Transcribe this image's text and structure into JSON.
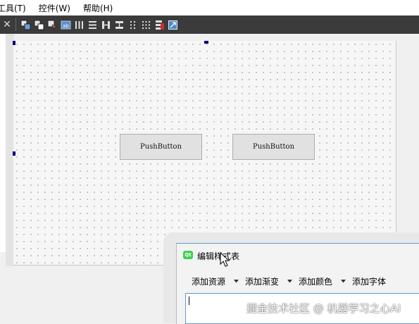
{
  "menubar": {
    "items": [
      {
        "label": "工具(T)"
      },
      {
        "label": "控件(W)"
      },
      {
        "label": "帮助(H)"
      }
    ]
  },
  "toolbar": {
    "close_icon": "close-icon",
    "buttons": [
      "add-widgets-icon",
      "remove-widgets-icon",
      "edit-signals-icon",
      "edit-buddies-icon",
      "layout-horizontal-icon",
      "layout-vertical-icon",
      "layout-horizontal-splitter-icon",
      "layout-vertical-splitter-icon",
      "layout-form-icon",
      "layout-grid-icon",
      "break-layout-icon",
      "adjust-size-icon"
    ]
  },
  "form": {
    "buttons": [
      {
        "label": "PushButton"
      },
      {
        "label": "PushButton"
      }
    ]
  },
  "dialog": {
    "icon_text": "Qt",
    "title": "编辑样式表",
    "menu": [
      {
        "label": "添加资源"
      },
      {
        "label": "添加渐变"
      },
      {
        "label": "添加颜色"
      },
      {
        "label": "添加字体"
      }
    ],
    "editor_value": ""
  },
  "watermark": "掘金技术社区 @ 机器学习之心AI",
  "colors": {
    "toolbar_bg": "#3b3b3b",
    "accent_blue": "#5b9bd5",
    "handle": "#000080",
    "qt_green": "#41cd52"
  }
}
